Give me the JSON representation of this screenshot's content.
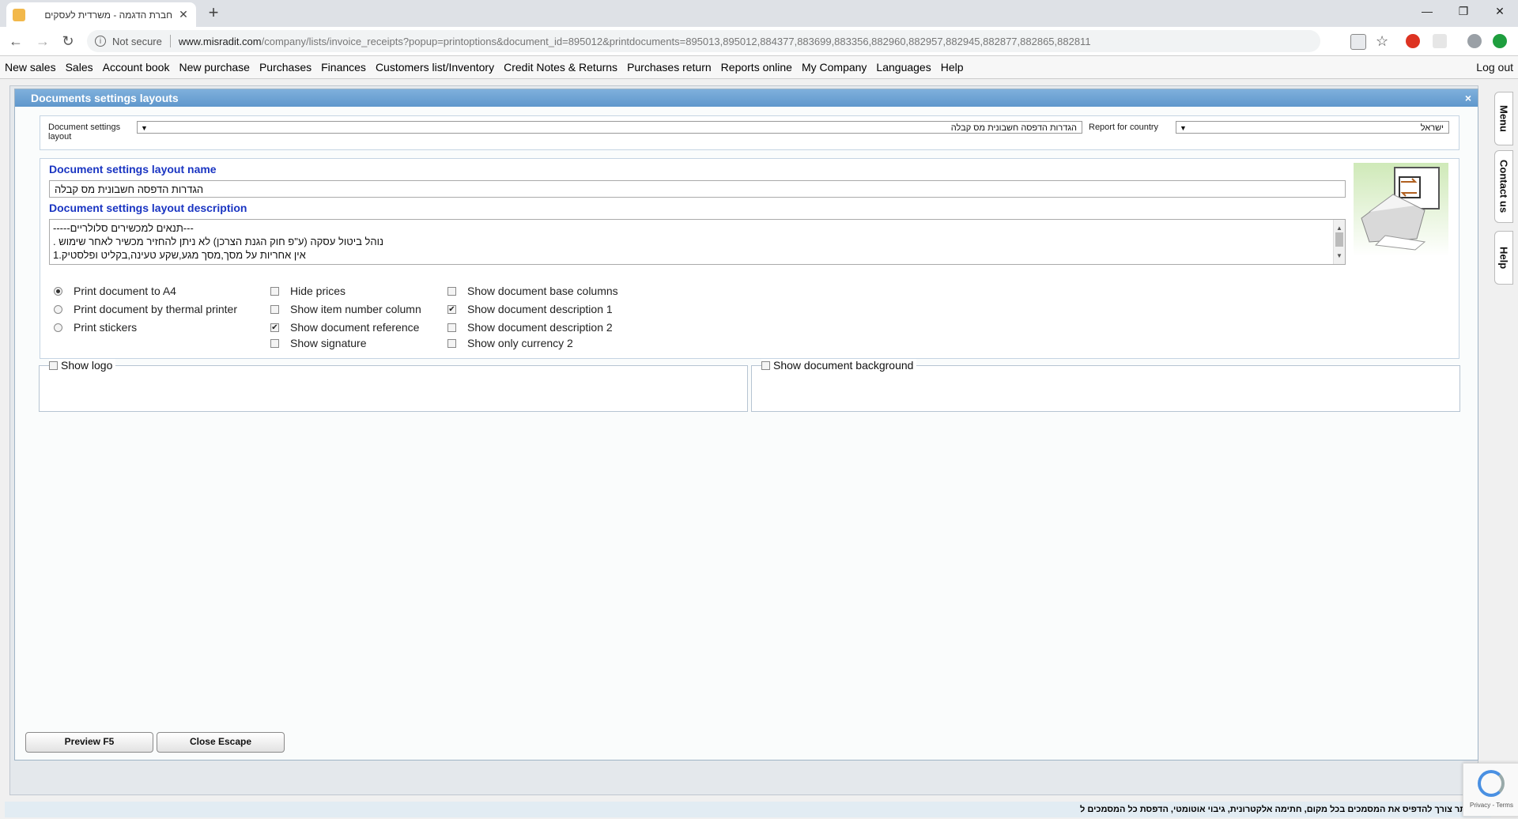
{
  "browser": {
    "tab_title": "חברת הדגמה - משרדית לעסקים",
    "tab_close": "✕",
    "new_tab": "+",
    "win_minimize": "—",
    "win_restore": "❐",
    "win_close": "✕",
    "back": "←",
    "forward": "→",
    "reload": "↻",
    "not_secure": "Not secure",
    "url_host": "www.misradit.com",
    "url_path": "/company/lists/invoice_receipts?popup=printoptions&document_id=895012&printdocuments=895013,895012,884377,883699,883356,882960,882957,882945,882877,882865,882811",
    "star": "☆"
  },
  "menubar": {
    "items": [
      "New sales",
      "Sales",
      "Account book",
      "New purchase",
      "Purchases",
      "Finances",
      "Customers list/Inventory",
      "Credit Notes & Returns",
      "Purchases return",
      "Reports online",
      "My Company",
      "Languages",
      "Help"
    ],
    "logout": "Log out"
  },
  "sidetabs": [
    "Menu",
    "Contact us",
    "Help"
  ],
  "dialog": {
    "title": "Documents settings layouts",
    "close": "×",
    "layout_label": "Document settings layout",
    "layout_value": "הגדרות הדפסה חשבונית מס קבלה",
    "country_label": "Report for country",
    "country_value": "ישראל",
    "name_heading": "Document settings layout name",
    "name_value": "הגדרות הדפסה חשבונית מס קבלה",
    "desc_heading": "Document settings layout description",
    "desc_lines": [
      "---תנאים למכשירים סלולריים-----",
      "נוהל ביטול עסקה (ע\"פ חוק הגנת הצרכן) לא ניתן להחזיר מכשיר לאחר שימוש .",
      "אין אחריות על מסך,מסך מגע,שקע טעינה,בקליט ופלסטיק.1"
    ],
    "print_options": [
      {
        "label": "Print document to A4",
        "checked": true
      },
      {
        "label": "Print document by thermal printer",
        "checked": false
      },
      {
        "label": "Print stickers",
        "checked": false
      }
    ],
    "col2_options": [
      {
        "label": "Hide prices",
        "checked": false
      },
      {
        "label": "Show item number column",
        "checked": false
      },
      {
        "label": "Show document reference",
        "checked": true
      },
      {
        "label": "Show signature",
        "checked": false
      }
    ],
    "col3_options": [
      {
        "label": "Show document base columns",
        "checked": false
      },
      {
        "label": "Show document description 1",
        "checked": true
      },
      {
        "label": "Show document description 2",
        "checked": false
      },
      {
        "label": "Show only currency 2",
        "checked": false
      }
    ],
    "show_logo": "Show logo",
    "show_background": "Show document background",
    "preview_button": "Preview F5",
    "close_button": "Close Escape"
  },
  "status_text": "אין יותר צורך להדפיס את המסמכים בכל מקום, חתימה אלקטרונית, גיבוי אוטומטי, הדפסת כל המסמכים ל",
  "recaptcha_text": "Privacy - Terms",
  "colors": {
    "accent": "#1a35c2",
    "title_bar": "#6fa4d6"
  }
}
